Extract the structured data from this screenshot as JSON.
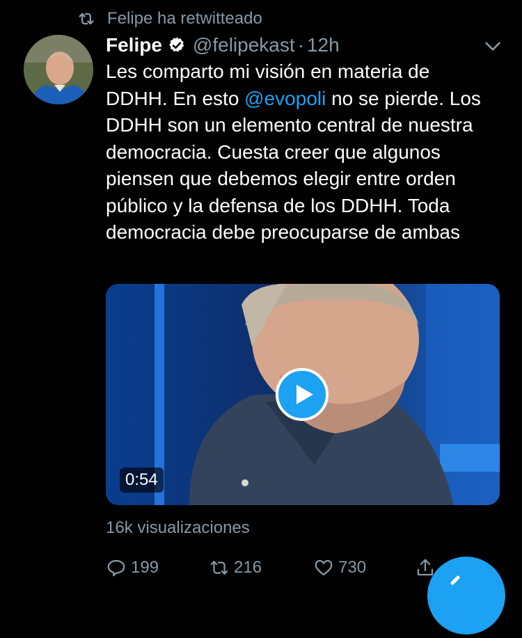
{
  "retweet": {
    "icon": "retweet-icon",
    "text": "Felipe ha retwitteado"
  },
  "tweet": {
    "avatar_icon": "avatar",
    "author_name": "Felipe",
    "verified_icon": "verified-badge-icon",
    "handle": "@felipekast",
    "separator": "·",
    "time": "12h",
    "text_part1": "Les comparto mi visión en materia de DDHH. En esto ",
    "mention": "@evopoli",
    "text_part2": " no se pierde. Los DDHH son un elemento central de nuestra democracia. Cuesta creer que algunos piensen que debemos elegir entre orden público y la defensa de los DDHH. Toda democracia debe preocuparse de ambas"
  },
  "media": {
    "duration": "0:54",
    "play_icon": "play-icon"
  },
  "views": "16k visualizaciones",
  "actions": {
    "reply_count": "199",
    "retweet_count": "216",
    "like_count": "730"
  },
  "colors": {
    "accent": "#1da1f2",
    "muted": "#8899a6",
    "background": "#000000"
  }
}
